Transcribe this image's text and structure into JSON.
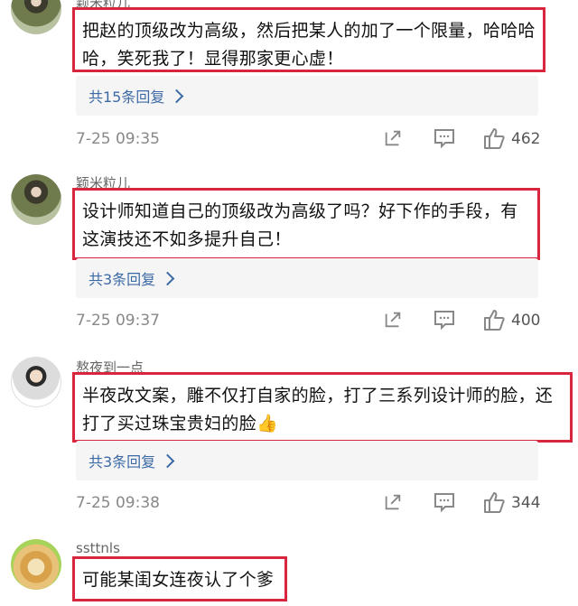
{
  "comments": [
    {
      "username": "颖米粒儿",
      "text": "把赵的顶级改为高级，然后把某人的加了一个限量，哈哈哈哈，笑死我了！显得那家更心虚！",
      "replies": "共15条回复",
      "time": "7-25 09:35",
      "likes": "462"
    },
    {
      "username": "颖米粒儿",
      "text": "设计师知道自己的顶级改为高级了吗？好下作的手段，有这演技还不如多提升自己！",
      "replies": "共3条回复",
      "time": "7-25 09:37",
      "likes": "400"
    },
    {
      "username": "熬夜到一点",
      "text": "半夜改文案，雕不仅打自家的脸，打了三系列设计师的脸，还打了买过珠宝贵妇的脸👍",
      "replies": "共3条回复",
      "time": "7-25 09:38",
      "likes": "344"
    },
    {
      "username": "ssttnls",
      "text": "可能某闺女连夜认了个爹"
    }
  ],
  "icons": {
    "share": "share-icon",
    "reply": "comment-icon",
    "like": "thumbs-up-icon",
    "chevron": "chevron-right-icon"
  },
  "colors": {
    "highlight_border": "#d7263d",
    "link": "#3d6aa6",
    "muted": "#888888"
  }
}
